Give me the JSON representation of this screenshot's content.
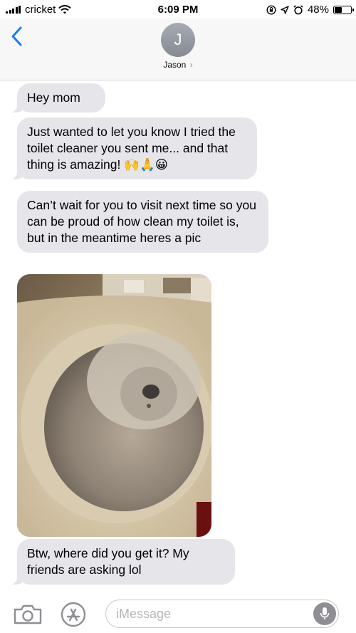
{
  "status_bar": {
    "carrier": "cricket",
    "time": "6:09 PM",
    "battery": "48%",
    "battery_level": 0.48
  },
  "header": {
    "avatar_initial": "J",
    "contact_name": "Jason",
    "contact_chevron": "›"
  },
  "messages": [
    {
      "text": "Hey mom"
    },
    {
      "text": "Just wanted to let you know I tried the toilet cleaner you sent me... and that thing is amazing! 🙌🙏😀"
    },
    {
      "text": "Can’t wait for you to visit next time so you can be proud of how clean my toilet is, but in the meantime heres a pic"
    },
    {
      "text": "Btw, where did you get it? My friends are asking lol"
    }
  ],
  "input": {
    "placeholder": "iMessage"
  },
  "icons": {
    "back": "chevron-left-icon",
    "wifi": "wifi-icon",
    "camera": "camera-icon",
    "app_store": "app-store-icon",
    "microphone": "microphone-icon"
  },
  "colors": {
    "accent": "#147efb",
    "bubble_received": "#e5e5ea"
  }
}
